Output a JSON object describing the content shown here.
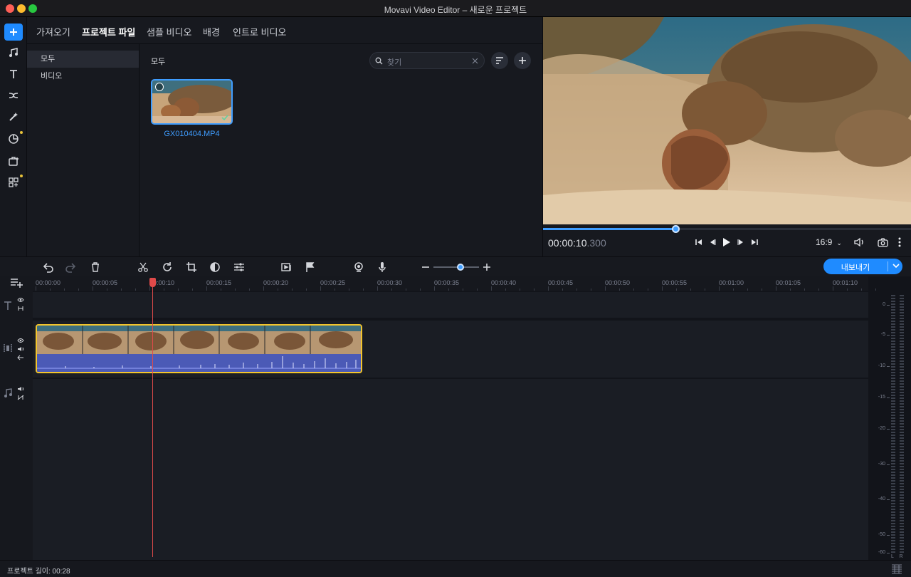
{
  "window": {
    "title": "Movavi Video Editor – 새로운 프로젝트"
  },
  "colors": {
    "accent": "#3f9dff",
    "clip_border": "#f3c52c",
    "playhead": "#e04a4a",
    "export_bg": "#1f8bff"
  },
  "sidebar": {
    "icons": [
      "add-icon",
      "music-icon",
      "text-icon",
      "transition-icon",
      "magic-wand-icon",
      "sticker-icon",
      "export-media-icon",
      "more-tools-icon"
    ]
  },
  "tabs": [
    "가져오기",
    "프로젝트 파일",
    "샘플 비디오",
    "배경",
    "인트로 비디오"
  ],
  "active_tab": "프로젝트 파일",
  "categories": [
    "모두",
    "비디오"
  ],
  "media": {
    "title": "모두",
    "search_placeholder": "찾기",
    "files": [
      {
        "name": "GX010404.MP4"
      }
    ]
  },
  "preview": {
    "time_main": "00:00:10",
    "time_ms": ".300",
    "aspect": "16:9",
    "progress": 0.36
  },
  "timeline": {
    "ruler": [
      "00:00:00",
      "00:00:05",
      "00:00:10",
      "00:00:15",
      "00:00:20",
      "00:00:25",
      "00:00:30",
      "00:00:35",
      "00:00:40",
      "00:00:45",
      "00:00:50",
      "00:00:55",
      "00:01:00",
      "00:01:05",
      "00:01:10"
    ],
    "zoom": 0.6,
    "export_label": "내보내기"
  },
  "meter": {
    "db_labels": [
      "0",
      "-5",
      "-10",
      "-15",
      "-20",
      "-30",
      "-40",
      "-50",
      "-60"
    ],
    "channels": [
      "L",
      "R"
    ]
  },
  "status": {
    "project_length": "프로젝트 길이: 00:28"
  }
}
